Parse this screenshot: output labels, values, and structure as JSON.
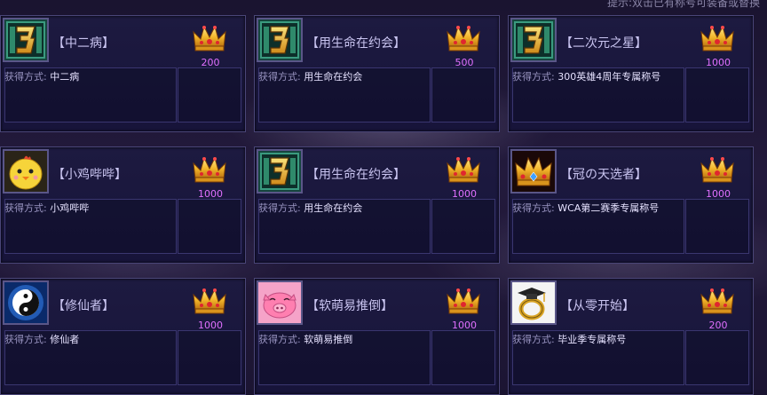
{
  "hint": "提示:双击已有称号可装备或替换",
  "obtain_label": "获得方式:",
  "cards": [
    {
      "title": "【中二病】",
      "points": "200",
      "obtain": "中二病",
      "icon": "digit-3-icon"
    },
    {
      "title": "【用生命在约会】",
      "points": "500",
      "obtain": "用生命在约会",
      "icon": "digit-3-icon"
    },
    {
      "title": "【二次元之星】",
      "points": "1000",
      "obtain": "300英雄4周年专属称号",
      "icon": "digit-3-icon"
    },
    {
      "title": "【小鸡哔哔】",
      "points": "1000",
      "obtain": "小鸡哔哔",
      "icon": "chick-icon"
    },
    {
      "title": "【用生命在约会】",
      "points": "1000",
      "obtain": "用生命在约会",
      "icon": "digit-3-icon"
    },
    {
      "title": "【冠の天选者】",
      "points": "1000",
      "obtain": "WCA第二赛季专属称号",
      "icon": "crown-icon"
    },
    {
      "title": "【修仙者】",
      "points": "1000",
      "obtain": "修仙者",
      "icon": "yin-yang-icon"
    },
    {
      "title": "【软萌易推倒】",
      "points": "1000",
      "obtain": "软萌易推倒",
      "icon": "pink-pig-icon"
    },
    {
      "title": "【从零开始】",
      "points": "200",
      "obtain": "毕业季专属称号",
      "icon": "ring-cap-icon"
    }
  ]
}
